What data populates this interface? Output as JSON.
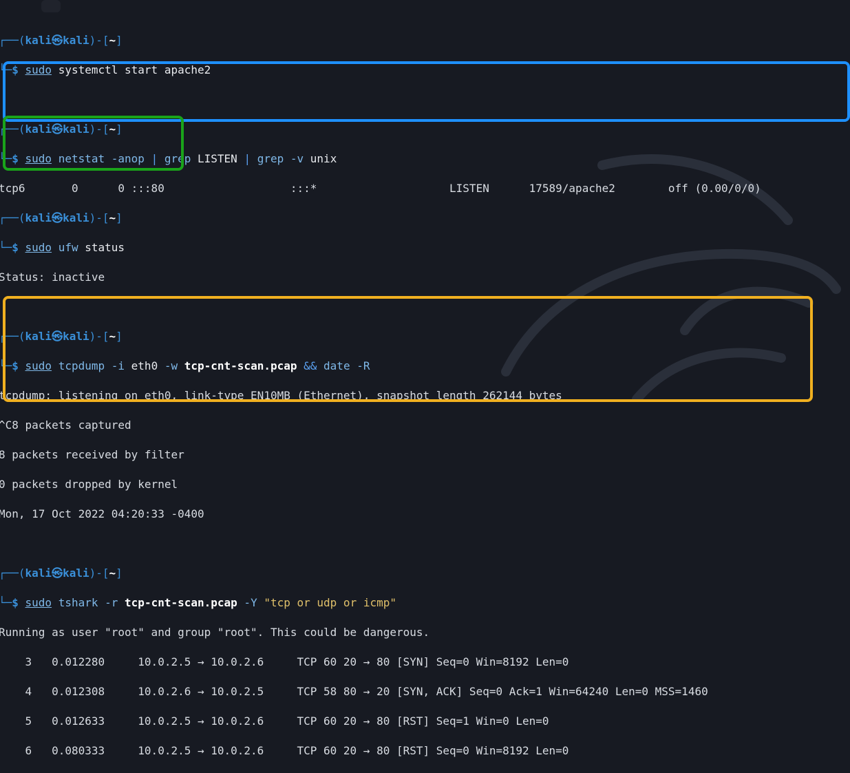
{
  "prompt": {
    "open": "┌──(",
    "user": "kali",
    "at": "㉿",
    "host": "kali",
    "mid": ")-[",
    "dir": "~",
    "close": "]",
    "arrow": "└─",
    "dollar": "$ "
  },
  "cmd1": {
    "sudo": "sudo",
    "rest": " systemctl start apache2"
  },
  "cmd2": {
    "sudo": "sudo",
    "part1": " netstat -anop ",
    "pipe1": "|",
    "grep1": " grep",
    "part2": " LISTEN ",
    "pipe2": "|",
    "grep2": " grep",
    "opt": " -v",
    "part3": " unix",
    "out": "tcp6       0      0 :::80                   :::*                    LISTEN      17589/apache2        off (0.00/0/0)"
  },
  "cmd3": {
    "sudo": "sudo",
    "rest": " ufw",
    "rest2": " status",
    "out": "Status: inactive"
  },
  "cmd4": {
    "sudo": "sudo",
    "a": " tcpdump",
    "opt1": " -i",
    "b": " eth0",
    "opt2": " -w",
    "file": " tcp-cnt-scan.pcap",
    "and": " &&",
    "c": " date",
    "opt3": " -R",
    "out": [
      "tcpdump: listening on eth0, link-type EN10MB (Ethernet), snapshot length 262144 bytes",
      "^C8 packets captured",
      "8 packets received by filter",
      "0 packets dropped by kernel",
      "Mon, 17 Oct 2022 04:20:33 -0400"
    ]
  },
  "cmd5": {
    "sudo": "sudo",
    "a": " tshark",
    "opt1": " -r",
    "file": " tcp-cnt-scan.pcap",
    "opt2": " -Y",
    "filter": " \"tcp or udp or icmp\"",
    "out": [
      "Running as user \"root\" and group \"root\". This could be dangerous.",
      "    3   0.012280     10.0.2.5 → 10.0.2.6     TCP 60 20 → 80 [SYN] Seq=0 Win=8192 Len=0",
      "    4   0.012308     10.0.2.6 → 10.0.2.5     TCP 58 80 → 20 [SYN, ACK] Seq=0 Ack=1 Win=64240 Len=0 MSS=1460",
      "    5   0.012633     10.0.2.5 → 10.0.2.6     TCP 60 20 → 80 [RST] Seq=1 Win=0 Len=0",
      "    6   0.080333     10.0.2.5 → 10.0.2.6     TCP 60 20 → 80 [RST] Seq=0 Win=8192 Len=0"
    ]
  },
  "colors": {
    "blue_box": "#1e90ff",
    "green_box": "#1aa31a",
    "yellow_box": "#f0b020",
    "background": "#171a22"
  }
}
